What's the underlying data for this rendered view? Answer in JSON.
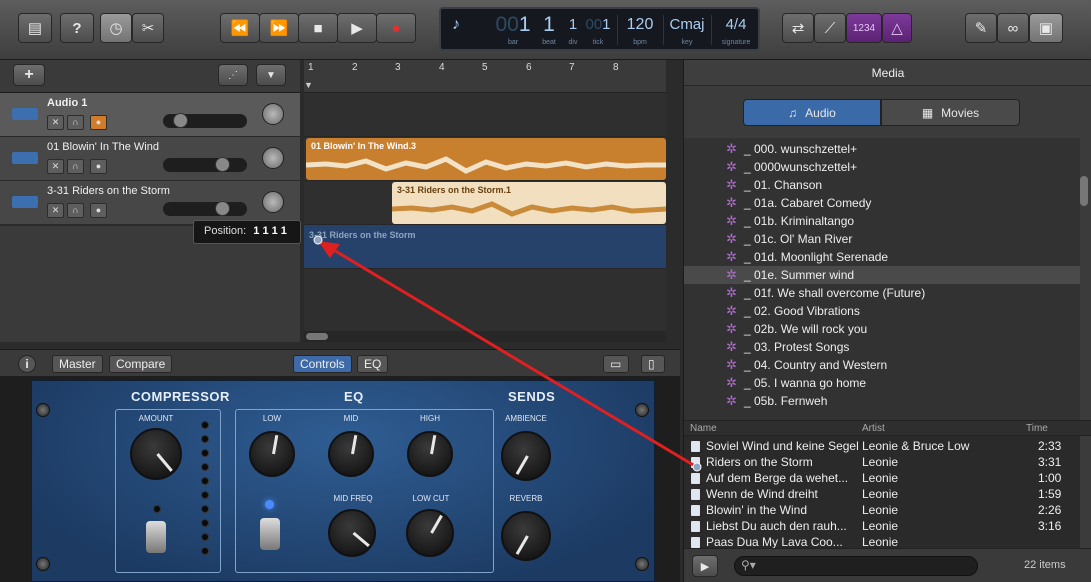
{
  "toolbar": {
    "library_icon": "library-icon",
    "help_label": "?",
    "smart_controls_icon": "smart-controls-icon",
    "editors_icon": "scissors-icon",
    "rewind_icon": "⏪",
    "forward_icon": "⏩",
    "stop_icon": "■",
    "play_icon": "▶",
    "record_icon": "●",
    "cycle_icon": "cycle-icon",
    "tuner_icon": "tuner-icon",
    "count_in_label": "1234",
    "metronome_icon": "metronome-icon",
    "notepad_icon": "notepad-icon",
    "loops_icon": "loops-icon",
    "media_icon": "media-browser-icon"
  },
  "lcd": {
    "bar": "1",
    "bar_prefix": "00",
    "beat": "1",
    "div": "1",
    "tick": "1",
    "tick_prefix": "00",
    "bpm": "120",
    "key": "Cmaj",
    "signature": "4/4",
    "labels": {
      "bar": "bar",
      "beat": "beat",
      "div": "div",
      "tick": "tick",
      "bpm": "bpm",
      "key": "key",
      "signature": "signature"
    }
  },
  "tracks_header": {
    "add_label": "+"
  },
  "tracks": [
    {
      "name": "Audio 1"
    },
    {
      "name": "01 Blowin' In The Wind"
    },
    {
      "name": "3-31 Riders on the Storm"
    }
  ],
  "ruler": {
    "ticks": [
      "1",
      "2",
      "3",
      "4",
      "5",
      "6",
      "7",
      "8"
    ]
  },
  "regions": [
    {
      "name": "01 Blowin' In The Wind.3"
    },
    {
      "name": "3-31 Riders on the Storm.1"
    },
    {
      "name": "3-31 Riders on the Storm"
    }
  ],
  "tooltip": {
    "label": "Position:",
    "value": "1 1 1 1"
  },
  "smart_controls": {
    "info_label": "i",
    "master_label": "Master",
    "compare_label": "Compare",
    "controls_tab": "Controls",
    "eq_tab": "EQ",
    "compressor_title": "COMPRESSOR",
    "amount_label": "AMOUNT",
    "eq_title": "EQ",
    "low_label": "LOW",
    "mid_label": "MID",
    "high_label": "HIGH",
    "mid_freq_label": "MID FREQ",
    "low_cut_label": "LOW CUT",
    "sends_title": "SENDS",
    "ambience_label": "AMBIENCE",
    "reverb_label": "REVERB"
  },
  "media": {
    "title": "Media",
    "audio_tab": "Audio",
    "movies_tab": "Movies",
    "folders": [
      "_ 000. wunschzettel+",
      "_ 0000wunschzettel+",
      "_ 01. Chanson",
      "_ 01a. Cabaret Comedy",
      "_ 01b. Kriminaltango",
      "_ 01c. Ol' Man River",
      "_ 01d. Moonlight Serenade",
      "_ 01e. Summer wind",
      "_ 01f. We shall overcome (Future)",
      "_ 02. Good Vibrations",
      "_ 02b. We will rock you",
      "_ 03. Protest Songs",
      "_ 04. Country and Western",
      "_ 05. I wanna go home",
      "_ 05b. Fernweh"
    ],
    "columns": {
      "name": "Name",
      "artist": "Artist",
      "time": "Time"
    },
    "songs": [
      {
        "name": "Soviel Wind und keine Segel",
        "artist": "Leonie & Bruce Low",
        "time": "2:33"
      },
      {
        "name": "Riders on the Storm",
        "artist": "Leonie",
        "time": "3:31"
      },
      {
        "name": "Auf dem Berge da wehet...",
        "artist": "Leonie",
        "time": "1:00"
      },
      {
        "name": "Wenn de Wind dreiht",
        "artist": "Leonie",
        "time": "1:59"
      },
      {
        "name": "Blowin' in the Wind",
        "artist": "Leonie",
        "time": "2:26"
      },
      {
        "name": "Liebst Du auch den rauh...",
        "artist": "Leonie",
        "time": "3:16"
      },
      {
        "name": "Paas Dua My Lava Coo...",
        "artist": "Leonie",
        "time": ""
      }
    ],
    "play_icon": "▶",
    "search_placeholder": "",
    "items_count": "22 items"
  },
  "annotation": {
    "color": "#e02020"
  }
}
